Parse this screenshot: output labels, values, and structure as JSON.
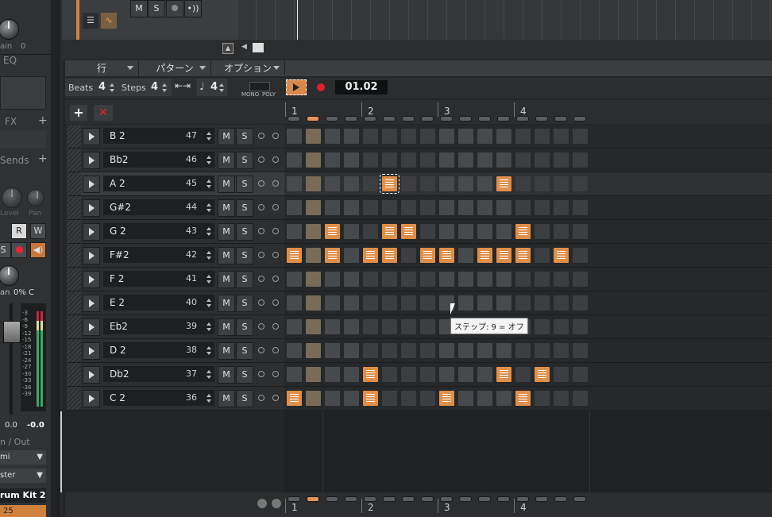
{
  "left_panel": {
    "gain_label": "ain",
    "gain_value": "0",
    "eq_label": "EQ",
    "fx_label": "FX",
    "sends_label": "Sends",
    "level_label": "Level",
    "pan_label": "Pan",
    "r_label": "R",
    "w_label": "W",
    "s_label": "S",
    "pan_value_label": "an",
    "pan_value": "0% C",
    "meter_scale": [
      "-3",
      "-6",
      "-9",
      "-12",
      "-15",
      "-18",
      "-21",
      "-24",
      "-27",
      "-30",
      "-33",
      "-36",
      "-39"
    ],
    "fader_value": "0.0",
    "peak_value": "-0.0",
    "inout_label": "n / Out",
    "input_select": "mi",
    "output_select": "ster",
    "instrument_name": "rum Kit 2",
    "instrument_number": "25"
  },
  "top_track": {
    "m_label": "M",
    "s_label": "S"
  },
  "menubar": {
    "row_menu": "行",
    "pattern_menu": "パターン",
    "options_menu": "オプション"
  },
  "toolbar": {
    "beats_label": "Beats",
    "beats_value": "4",
    "steps_label": "Steps",
    "steps_value": "4",
    "note_value": "4",
    "mono_label": "MONO",
    "poly_label": "POLY",
    "time": "01.02"
  },
  "header": {
    "add_label": "+",
    "delete_label": "✕",
    "bars": [
      "1",
      "2",
      "3",
      "4"
    ]
  },
  "rows": [
    {
      "note": "B 2",
      "pitch": "47",
      "m": "M",
      "s": "S",
      "steps": []
    },
    {
      "note": "Bb2",
      "pitch": "46",
      "m": "M",
      "s": "S",
      "steps": []
    },
    {
      "note": "A 2",
      "pitch": "45",
      "m": "M",
      "s": "S",
      "steps": [
        6,
        12
      ],
      "selected": true
    },
    {
      "note": "G#2",
      "pitch": "44",
      "m": "M",
      "s": "S",
      "steps": []
    },
    {
      "note": "G 2",
      "pitch": "43",
      "m": "M",
      "s": "S",
      "steps": [
        3,
        6,
        7,
        13
      ]
    },
    {
      "note": "F#2",
      "pitch": "42",
      "m": "M",
      "s": "S",
      "steps": [
        1,
        3,
        5,
        6,
        8,
        9,
        11,
        12,
        13,
        15
      ]
    },
    {
      "note": "F 2",
      "pitch": "41",
      "m": "M",
      "s": "S",
      "steps": []
    },
    {
      "note": "E 2",
      "pitch": "40",
      "m": "M",
      "s": "S",
      "steps": []
    },
    {
      "note": "Eb2",
      "pitch": "39",
      "m": "M",
      "s": "S",
      "steps": []
    },
    {
      "note": "D 2",
      "pitch": "38",
      "m": "M",
      "s": "S",
      "steps": []
    },
    {
      "note": "Db2",
      "pitch": "37",
      "m": "M",
      "s": "S",
      "steps": [
        5,
        12,
        14
      ]
    },
    {
      "note": "C 2",
      "pitch": "36",
      "m": "M",
      "s": "S",
      "steps": [
        1,
        5,
        9,
        13
      ]
    }
  ],
  "tooltip": "ステップ: 9 = オフ"
}
